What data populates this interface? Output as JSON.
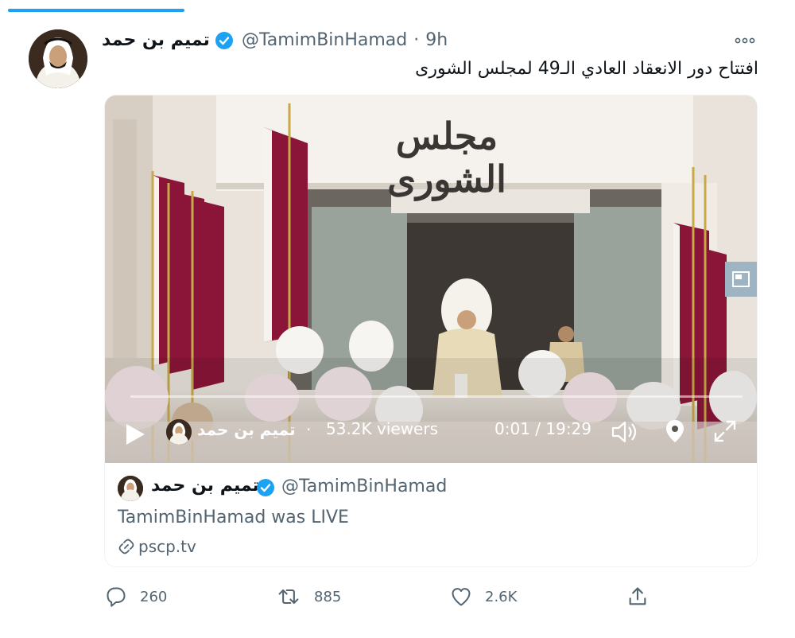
{
  "tweet": {
    "author_name": "تميم بن حمد",
    "handle": "@TamimBinHamad",
    "separator": "·",
    "time": "9h",
    "text": "افتتاح دور الانعقاد العادي الـ49 لمجلس الشورى",
    "more_icon": "more-icon"
  },
  "video": {
    "sign_text": "مجلس الشورى",
    "channel_name": "تميم بن حمد",
    "separator": "·",
    "viewers": "53.2K viewers",
    "timecode": "0:01 / 19:29",
    "progress": 0.001
  },
  "card": {
    "author_name": "تميم بن حمد",
    "handle": "@TamimBinHamad",
    "status": "TamimBinHamad was LIVE",
    "link": "pscp.tv"
  },
  "actions": {
    "replies": "260",
    "retweets": "885",
    "likes": "2.6K"
  },
  "colors": {
    "accent": "#1da1f2",
    "text_secondary": "#536471",
    "qatar_maroon": "#8a1538"
  }
}
